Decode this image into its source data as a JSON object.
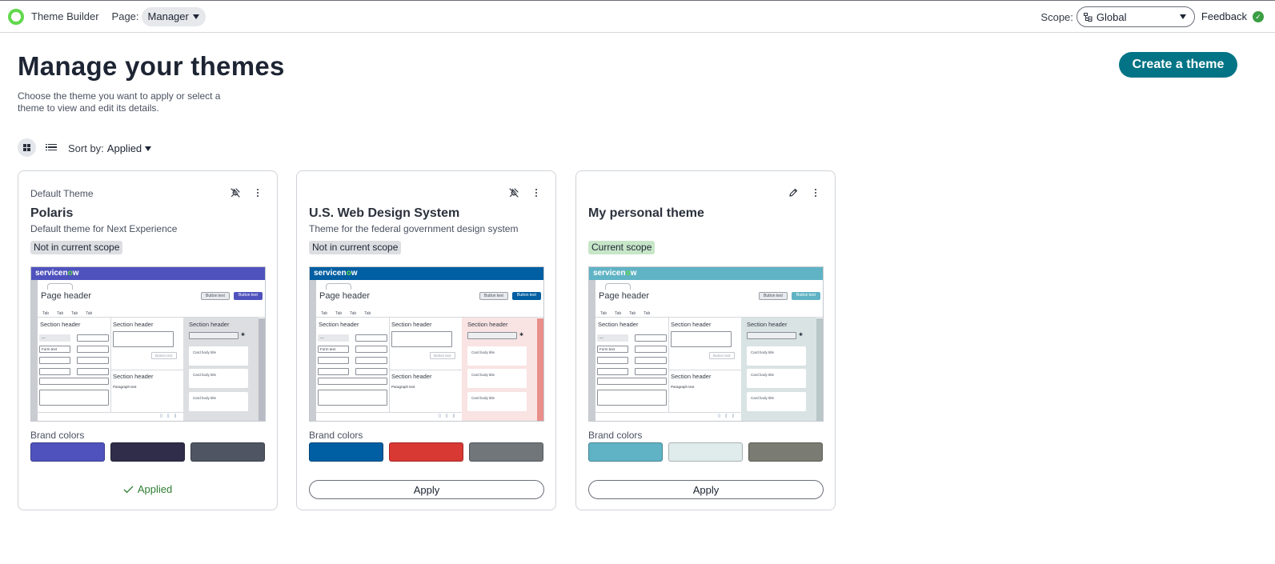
{
  "topbar": {
    "app_title": "Theme Builder",
    "page_label": "Page:",
    "page_value": "Manager",
    "scope_label": "Scope:",
    "scope_value": "Global",
    "feedback": "Feedback"
  },
  "header": {
    "title": "Manage your themes",
    "description": "Choose the theme you want to apply or select a theme to view and edit its details.",
    "create_button": "Create a theme"
  },
  "toolbar": {
    "sort_label": "Sort by:",
    "sort_value": "Applied"
  },
  "preview_text": {
    "brand_a": "servicen",
    "brand_o": "o",
    "brand_b": "w",
    "page_header": "Page header",
    "button_text": "Button text",
    "tab": "Tab",
    "section_header": "Section header",
    "form_text": "Form text",
    "card_body_title": "Card body title",
    "paragraph_text": "Paragraph text",
    "placeholder_dash": "—"
  },
  "brand_colors_label": "Brand colors",
  "cards": [
    {
      "label": "Default Theme",
      "name": "Polaris",
      "description": "Default theme for Next Experience",
      "scope": "Not in current scope",
      "status": "Applied",
      "colors": {
        "primary": "#4f52bd",
        "secondary": "#2f2d4a",
        "tertiary": "#4f5563",
        "preview_header": "#4f52bd",
        "preview_panel": "#dcdee2",
        "preview_rightbar": "#b8bbc3"
      }
    },
    {
      "label": "",
      "name": "U.S. Web Design System",
      "description": "Theme for the federal government design system",
      "scope": "Not in current scope",
      "action": "Apply",
      "colors": {
        "primary": "#005ea2",
        "secondary": "#d83933",
        "tertiary": "#71767a",
        "preview_header": "#005ea2",
        "preview_panel": "#f9e3e3",
        "preview_rightbar": "#e88f8c"
      }
    },
    {
      "label": "",
      "name": "My personal theme",
      "description": "",
      "scope": "Current scope",
      "action": "Apply",
      "colors": {
        "primary": "#5fb3c4",
        "secondary": "#e0ebec",
        "tertiary": "#7a7c74",
        "preview_header": "#5fb3c4",
        "preview_panel": "#d9e3e4",
        "preview_rightbar": "#b9c7c9"
      }
    }
  ]
}
